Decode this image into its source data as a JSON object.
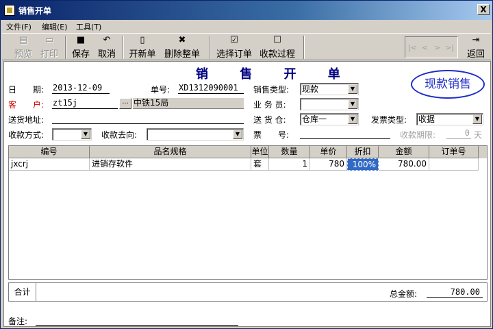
{
  "window": {
    "title": "销售开单",
    "close_glyph": "X"
  },
  "menu": [
    "文件(F)",
    "编辑(E)",
    "工具(T)"
  ],
  "toolbar": {
    "preview": "预览",
    "print": "打印",
    "save": "保存",
    "cancel": "取消",
    "new_doc": "开新单",
    "delete_doc": "删除整单",
    "select_order": "选择订单",
    "collect_process": "收款过程",
    "back": "返回"
  },
  "nav": {
    "first": "|<",
    "prev": "<",
    "next": ">",
    "last": ">|"
  },
  "form": {
    "title": "销 售 开 单",
    "stamp": "现款销售",
    "date_label": "日　　期:",
    "date_value": "2013-12-09",
    "doc_no_label": "单号:",
    "doc_no_value": "XD1312090001",
    "sale_type_label": "销售类型:",
    "sale_type_value": "现款",
    "customer_label": "客　　户:",
    "customer_code": "zt15j",
    "customer_browse": "...",
    "customer_name": "中铁15局",
    "salesman_label": "业 务 员:",
    "salesman_value": "",
    "delivery_addr_label": "送货地址:",
    "delivery_addr_value": "",
    "warehouse_label": "送 货 仓:",
    "warehouse_value": "仓库一",
    "invoice_type_label": "发票类型:",
    "invoice_type_value": "收据",
    "pay_method_label": "收款方式:",
    "pay_method_value": "",
    "pay_dest_label": "收款去向:",
    "pay_dest_value": "",
    "invoice_no_label": "票　　号:",
    "invoice_no_value": "",
    "pay_term_label": "收款期限:",
    "pay_term_value": "0",
    "pay_term_unit": "天"
  },
  "grid": {
    "columns": [
      "编号",
      "品名规格",
      "单位",
      "数量",
      "单价",
      "折扣",
      "金额",
      "订单号"
    ],
    "rows": [
      {
        "code": "jxcrj",
        "name": "进销存软件",
        "unit": "套",
        "qty": "1",
        "price": "780",
        "discount": "100%",
        "amount": "780.00",
        "order_no": ""
      }
    ]
  },
  "totals": {
    "label": "合计",
    "total_label": "总金额:",
    "total_value": "780.00"
  },
  "remark": {
    "label": "备注:",
    "value": ""
  }
}
